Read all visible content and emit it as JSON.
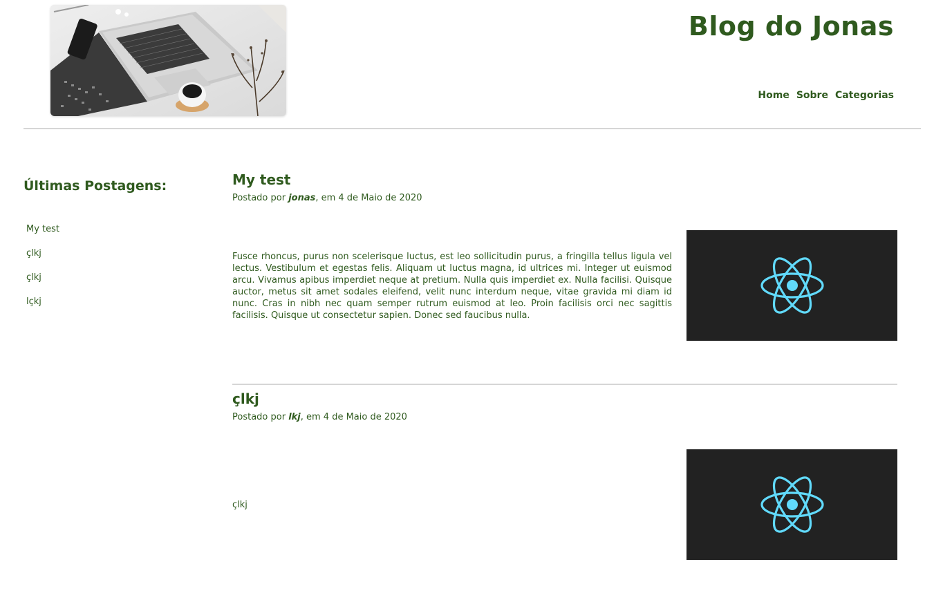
{
  "header": {
    "site_title": "Blog do Jonas",
    "nav": [
      "Home",
      "Sobre",
      "Categorias"
    ]
  },
  "sidebar": {
    "title": "Últimas Postagens:",
    "items": [
      "My test",
      "çlkj",
      "çlkj",
      "lçkj"
    ]
  },
  "posts": [
    {
      "title": "My test",
      "meta_prefix": "Postado por ",
      "author": "jonas",
      "meta_suffix": ", em 4 de Maio de 2020",
      "body": "Fusce rhoncus, purus non scelerisque luctus, est leo sollicitudin purus, a fringilla tellus ligula vel lectus. Vestibulum et egestas felis. Aliquam ut luctus magna, id ultrices mi. Integer ut euismod arcu. Vivamus apibus imperdiet neque at pretium. Nulla quis imperdiet ex. Nulla facilisi. Quisque auctor, metus sit amet sodales eleifend, velit nunc interdum neque, vitae gravida mi diam id nunc. Cras in nibh nec quam semper rutrum euismod at leo. Proin facilisis orci nec sagittis facilisis. Quisque ut consectetur sapien. Donec sed faucibus nulla.",
      "thumbnail_icon": "react-logo-icon"
    },
    {
      "title": "çlkj",
      "meta_prefix": "Postado por ",
      "author": "lkj",
      "meta_suffix": ", em 4 de Maio de 2020",
      "body": "çlkj",
      "thumbnail_icon": "react-logo-icon"
    }
  ],
  "colors": {
    "accent": "#2f5a1e",
    "thumbnail_bg": "#222222",
    "react_logo": "#61dafb",
    "divider": "#d6d6d6"
  }
}
